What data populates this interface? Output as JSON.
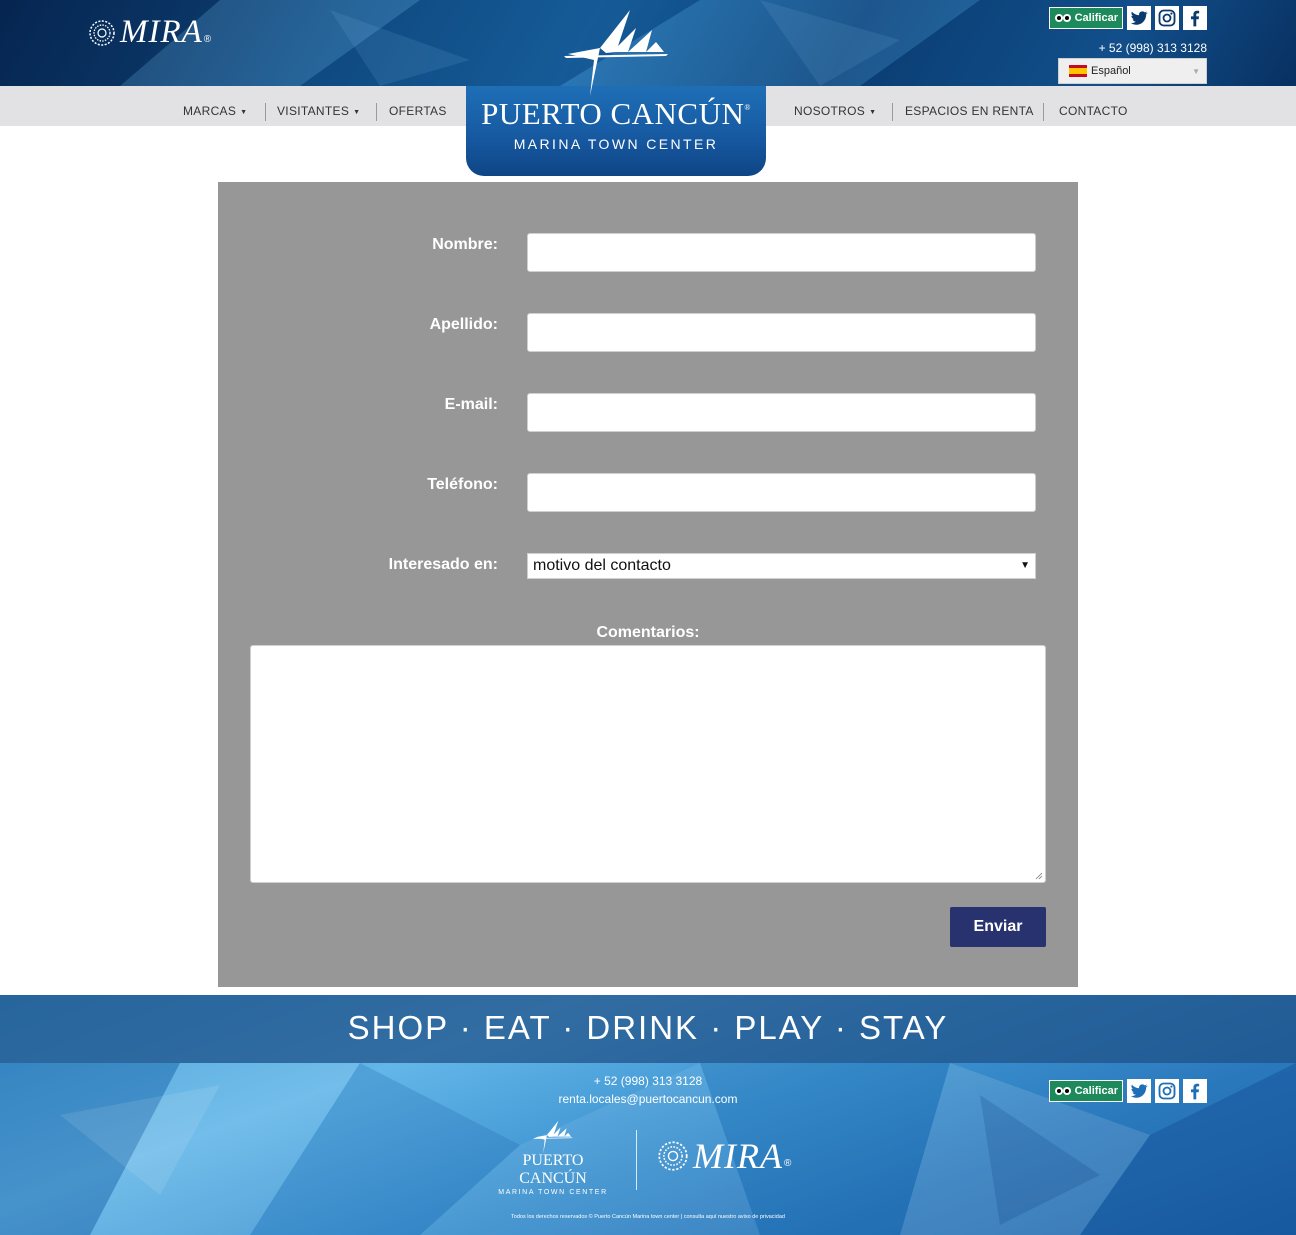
{
  "header": {
    "brand_left": "MIRA",
    "brand_left_reg": "®",
    "tripadvisor_label": "Calificar",
    "phone": "+ 52 (998) 313 3128",
    "language": "Español"
  },
  "nav": {
    "marcas": "MARCAS",
    "visitantes": "VISITANTES",
    "ofertas": "OFERTAS",
    "nosotros": "NOSOTROS",
    "espacios": "ESPACIOS EN RENTA",
    "contacto": "CONTACTO",
    "dropdown_arrow": "▼"
  },
  "logo": {
    "title": "PUERTO CANCÚN",
    "reg": "®",
    "subtitle": "MARINA TOWN CENTER"
  },
  "form": {
    "nombre_label": "Nombre:",
    "apellido_label": "Apellido:",
    "email_label": "E-mail:",
    "telefono_label": "Teléfono:",
    "interesado_label": "Interesado en:",
    "interesado_value": "motivo del contacto",
    "comentarios_label": "Comentarios:",
    "submit_label": "Enviar"
  },
  "footer": {
    "tagline": "SHOP · EAT · DRINK · PLAY · STAY",
    "phone": "+ 52 (998) 313 3128",
    "email": "renta.locales@puertocancun.com",
    "tripadvisor_label": "Calificar",
    "logo_title": "PUERTO CANCÚN",
    "logo_subtitle": "MARINA TOWN CENTER",
    "mira": "MIRA",
    "mira_reg": "®",
    "legal": "Todos los derechos reservados © Puerto Cancún Marina town center | consulta aquí nuestro aviso de privacidad"
  },
  "colors": {
    "form_bg": "#979797",
    "submit_bg": "#27326e",
    "nav_bg": "#e2e2e5",
    "tripadvisor_green": "#1d8a5b"
  }
}
